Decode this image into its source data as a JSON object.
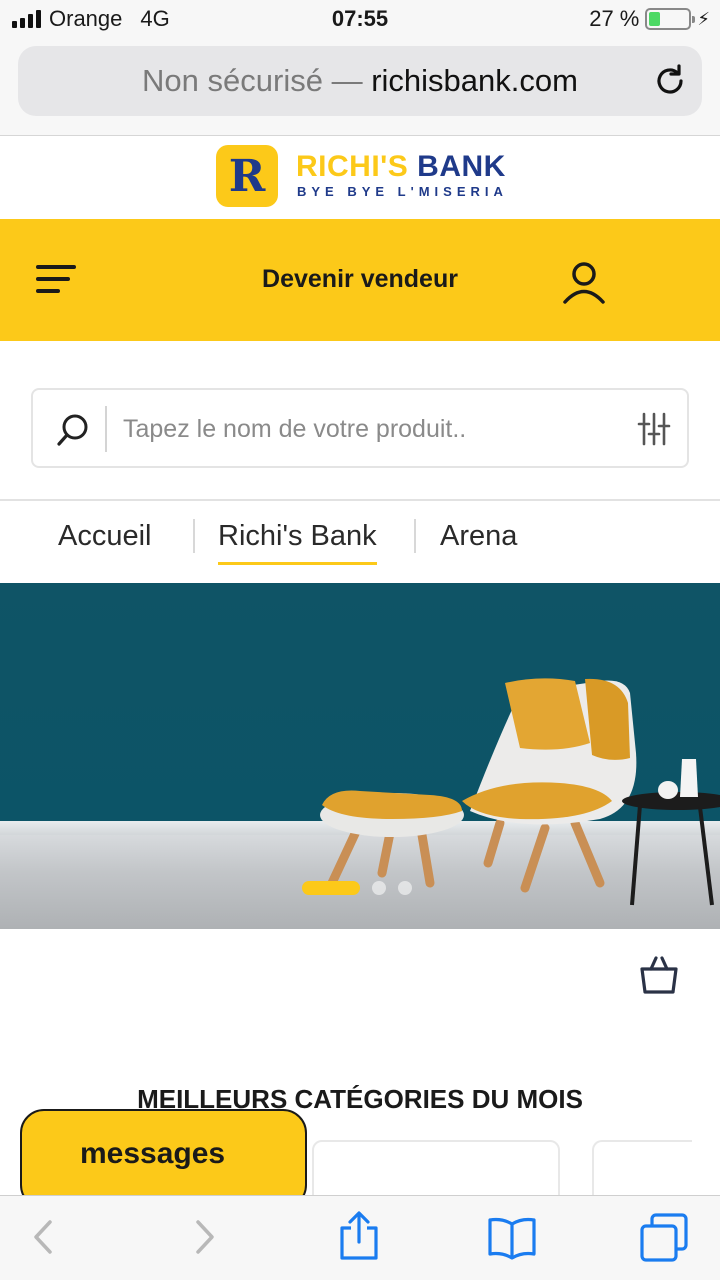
{
  "status_bar": {
    "carrier": "Orange",
    "network": "4G",
    "time": "07:55",
    "battery_percent": "27 %",
    "battery_level": 0.27
  },
  "browser": {
    "url_prefix": "Non sécurisé —",
    "url_domain": "richisbank.com"
  },
  "brand": {
    "logo_letter": "R",
    "name_part1": "RICHI'S",
    "name_part2": "BANK",
    "tagline": "BYE BYE L'MISERIA",
    "primary_color": "#fcc919",
    "secondary_color": "#1f3a8a"
  },
  "nav": {
    "cta_label": "Devenir vendeur"
  },
  "search": {
    "placeholder": "Tapez le nom de votre produit.."
  },
  "tabs": [
    {
      "label": "Accueil",
      "active": false
    },
    {
      "label": "Richi's Bank",
      "active": true
    },
    {
      "label": "Arena",
      "active": false
    }
  ],
  "carousel": {
    "slide_count": 3,
    "active_index": 0
  },
  "section": {
    "title": "MEILLEURS CATÉGORIES DU MOIS"
  },
  "messages": {
    "label": "messages"
  },
  "icons": {
    "menu": "hamburger-menu-icon",
    "user": "user-icon",
    "search": "search-icon",
    "filter": "filter-sliders-icon",
    "cart": "shopping-bag-icon",
    "reload": "reload-icon",
    "back": "chevron-left-icon",
    "forward": "chevron-right-icon",
    "share": "share-icon",
    "bookmarks": "bookmarks-book-icon",
    "tabs": "tabs-icon"
  }
}
